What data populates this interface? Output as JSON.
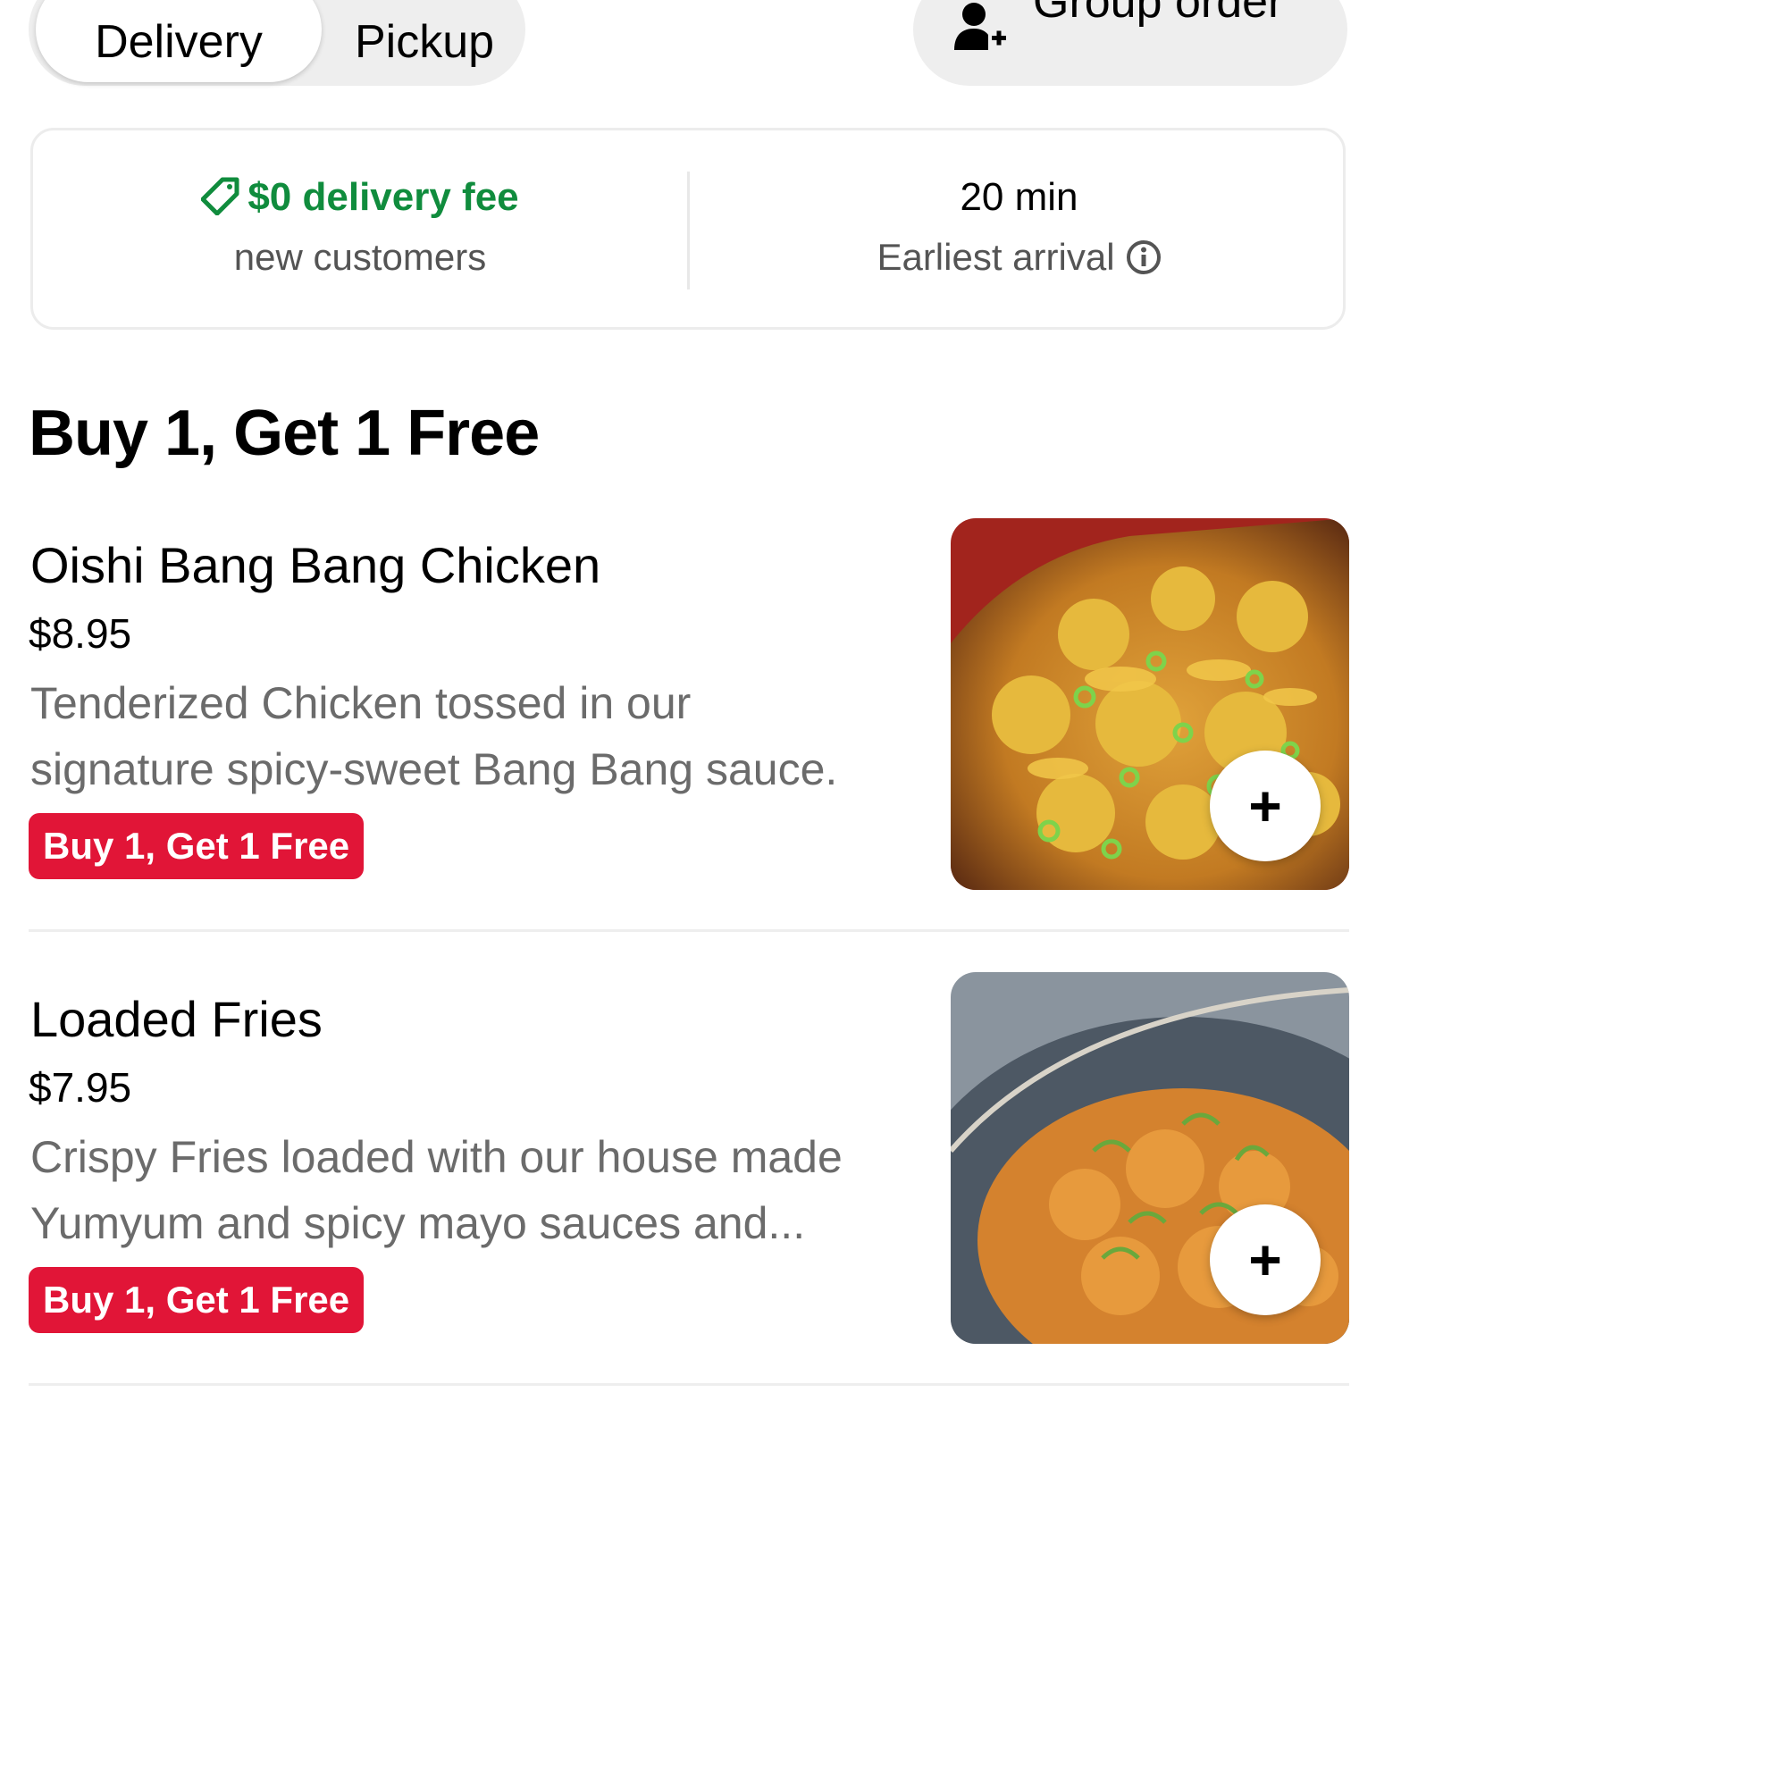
{
  "mode_toggle": {
    "delivery_label": "Delivery",
    "pickup_label": "Pickup",
    "selected": "Delivery"
  },
  "group_order": {
    "label": "Group order",
    "icon": "add-person-icon"
  },
  "info": {
    "fee_label": "$0 delivery fee",
    "fee_sub": "new customers",
    "time_label": "20 min",
    "time_sub": "Earliest arrival",
    "fee_color": "#108c3d"
  },
  "section": {
    "title": "Buy 1, Get 1 Free"
  },
  "items": [
    {
      "name": "Oishi Bang Bang Chicken",
      "price": "$8.95",
      "desc_line1": "Tenderized Chicken tossed in our",
      "desc_line2": "signature spicy-sweet Bang Bang sauce.",
      "badge": "Buy 1, Get 1 Free",
      "add_label": "+"
    },
    {
      "name": "Loaded Fries",
      "price": "$7.95",
      "desc_line1": "Crispy Fries loaded with our house made",
      "desc_line2": "Yumyum and spicy mayo sauces and...",
      "badge": "Buy 1, Get 1 Free",
      "add_label": "+"
    }
  ],
  "colors": {
    "badge": "#e11537",
    "promo_green": "#108c3d"
  }
}
